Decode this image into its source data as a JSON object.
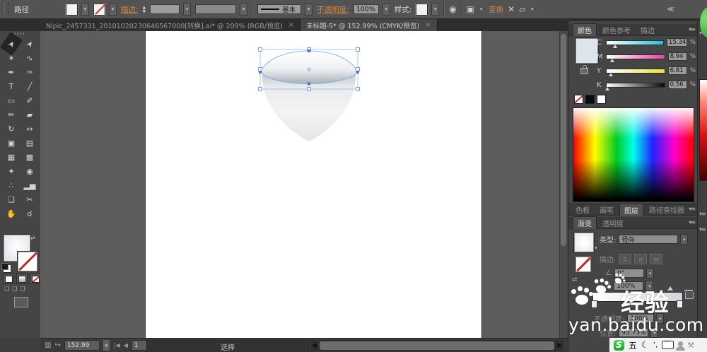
{
  "control_bar": {
    "context_label": "路径",
    "stroke_label": "描边:",
    "stroke_weight_value": "",
    "brush_definition": "基本",
    "opacity_label": "不透明度:",
    "opacity_value": "100%",
    "style_label": "样式:",
    "transform_label": "变换"
  },
  "doc_tabs": [
    {
      "title": "Nipic_2457331_20101020230646567000[转换].ai* @ 209% (RGB/预览)",
      "close": "×",
      "active": false
    },
    {
      "title": "未标题-5* @ 152.99% (CMYK/预览)",
      "close": "×",
      "active": true
    }
  ],
  "toolbar": {
    "tools": [
      {
        "name": "selection-tool",
        "glyph": "➤",
        "active": true
      },
      {
        "name": "direct-selection-tool",
        "glyph": "➤"
      },
      {
        "name": "magic-wand-tool",
        "glyph": "✶"
      },
      {
        "name": "lasso-tool",
        "glyph": "∿"
      },
      {
        "name": "pen-tool",
        "glyph": "✒"
      },
      {
        "name": "brush-pen-tool",
        "glyph": "✑"
      },
      {
        "name": "type-tool",
        "glyph": "T"
      },
      {
        "name": "line-segment-tool",
        "glyph": "╱"
      },
      {
        "name": "rectangle-tool",
        "glyph": "▭"
      },
      {
        "name": "paintbrush-tool",
        "glyph": "✐"
      },
      {
        "name": "pencil-tool",
        "glyph": "✏"
      },
      {
        "name": "eraser-tool",
        "glyph": "▰"
      },
      {
        "name": "rotate-tool",
        "glyph": "↻"
      },
      {
        "name": "width-tool",
        "glyph": "↔"
      },
      {
        "name": "shape-builder-tool",
        "glyph": "▣"
      },
      {
        "name": "perspective-grid-tool",
        "glyph": "▤"
      },
      {
        "name": "mesh-tool",
        "glyph": "▦"
      },
      {
        "name": "gradient-tool",
        "glyph": "▩"
      },
      {
        "name": "eyedropper-tool",
        "glyph": "✦"
      },
      {
        "name": "blend-tool",
        "glyph": "◉"
      },
      {
        "name": "symbol-sprayer-tool",
        "glyph": "∴"
      },
      {
        "name": "column-graph-tool",
        "glyph": "▂▅"
      },
      {
        "name": "artboard-tool",
        "glyph": "❏"
      },
      {
        "name": "slice-tool",
        "glyph": "✂"
      },
      {
        "name": "hand-tool",
        "glyph": "✋"
      },
      {
        "name": "zoom-tool",
        "glyph": "☌"
      }
    ]
  },
  "color_panel": {
    "tabs": [
      {
        "label": "颜色",
        "active": true
      },
      {
        "label": "颜色参考",
        "active": false
      },
      {
        "label": "描边",
        "active": false
      }
    ],
    "swatch_color": "#dee4eb",
    "percent": "%",
    "sliders": [
      {
        "label": "C",
        "value": "15.34",
        "track": "linear-gradient(to right,#ffffff,#1fc3da)"
      },
      {
        "label": "M",
        "value": "8.94",
        "track": "linear-gradient(to right,#ffffff,#ec3fa4)"
      },
      {
        "label": "Y",
        "value": "6.81",
        "track": "linear-gradient(to right,#ffffff,#e8e53c)"
      },
      {
        "label": "K",
        "value": "0.56",
        "track": "linear-gradient(to right,#ffffff,#0a0a0a)"
      }
    ]
  },
  "middle_tabs": [
    {
      "label": "色板",
      "active": false
    },
    {
      "label": "画笔",
      "active": false
    },
    {
      "label": "图层",
      "active": true
    },
    {
      "label": "路径查找器",
      "active": false
    }
  ],
  "gradient_panel": {
    "tabs": [
      {
        "label": "渐变",
        "active": true
      },
      {
        "label": "透明度",
        "active": false
      }
    ],
    "type_label": "类型:",
    "type_value": "径向",
    "stroke_label": "描边:",
    "angle_value": "0°",
    "aspect_value": "100%",
    "opacity_label": "不透明度:",
    "opacity_value": "100%",
    "location_label": "位置:",
    "location_value": "93.73%"
  },
  "status_bar": {
    "zoom_value": "152.99",
    "artboard_value": "1",
    "tool_status": "选择"
  },
  "watermark": {
    "brand": "经验",
    "url": "yan.baidu.com"
  },
  "tray": {
    "ime_logo": "S",
    "ime_mode": "五",
    "marks": "’,"
  },
  "icons": {
    "dropdown": "▾",
    "menu": "▾≡",
    "collapse": "≪",
    "recolor": "◉",
    "align": "▣",
    "free_transform": "✕",
    "shear": "▱",
    "moon": "☾",
    "wrench": "⚒",
    "swap": "⇄",
    "preview": "▥",
    "publish": "↪",
    "nav_first": "|◀",
    "nav_prev": "◀",
    "nav_next": "▶",
    "nav_last": "▶|",
    "angle": "∠",
    "aspect": "⊿"
  }
}
